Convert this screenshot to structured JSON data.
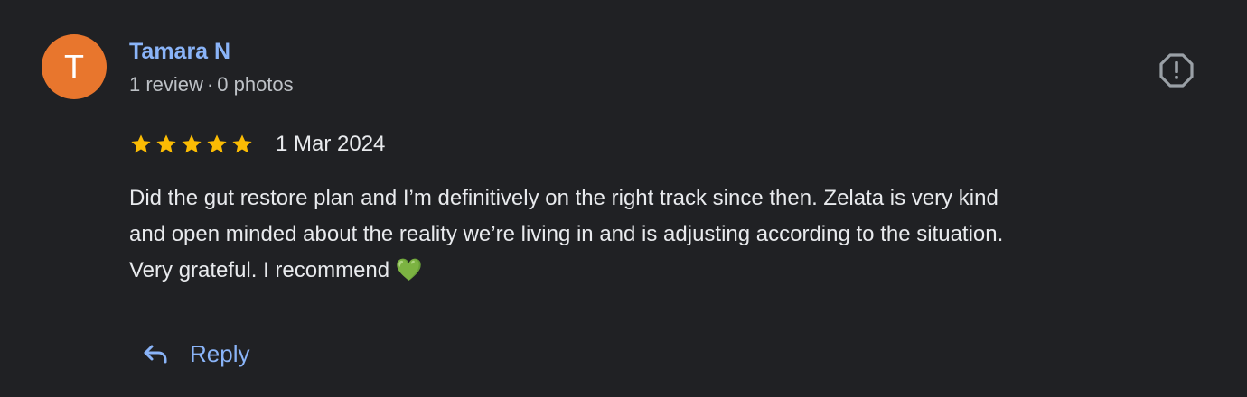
{
  "reviewer": {
    "initial": "T",
    "avatar_color": "#e8762d",
    "name": "Tamara N",
    "reviews_count": "1 review",
    "separator": "·",
    "photos_count": "0 photos"
  },
  "review": {
    "rating": 5,
    "rating_max": 5,
    "star_color": "#fbbc04",
    "date": "1 Mar 2024",
    "text_line_1": "Did the gut restore plan and I’m definitively on the right track since then. Zelata is very kind",
    "text_line_2": "and open minded about the reality we’re living in and is adjusting according to the situation.",
    "text_line_3": "Very grateful. I recommend 💚"
  },
  "actions": {
    "report_icon": "report-icon",
    "reply_icon": "reply-arrow-icon",
    "reply_label": "Reply"
  },
  "colors": {
    "background": "#202124",
    "link": "#8ab4f8",
    "text": "#e8eaed",
    "secondary_text": "#bdc1c6",
    "icon": "#9aa0a6"
  }
}
